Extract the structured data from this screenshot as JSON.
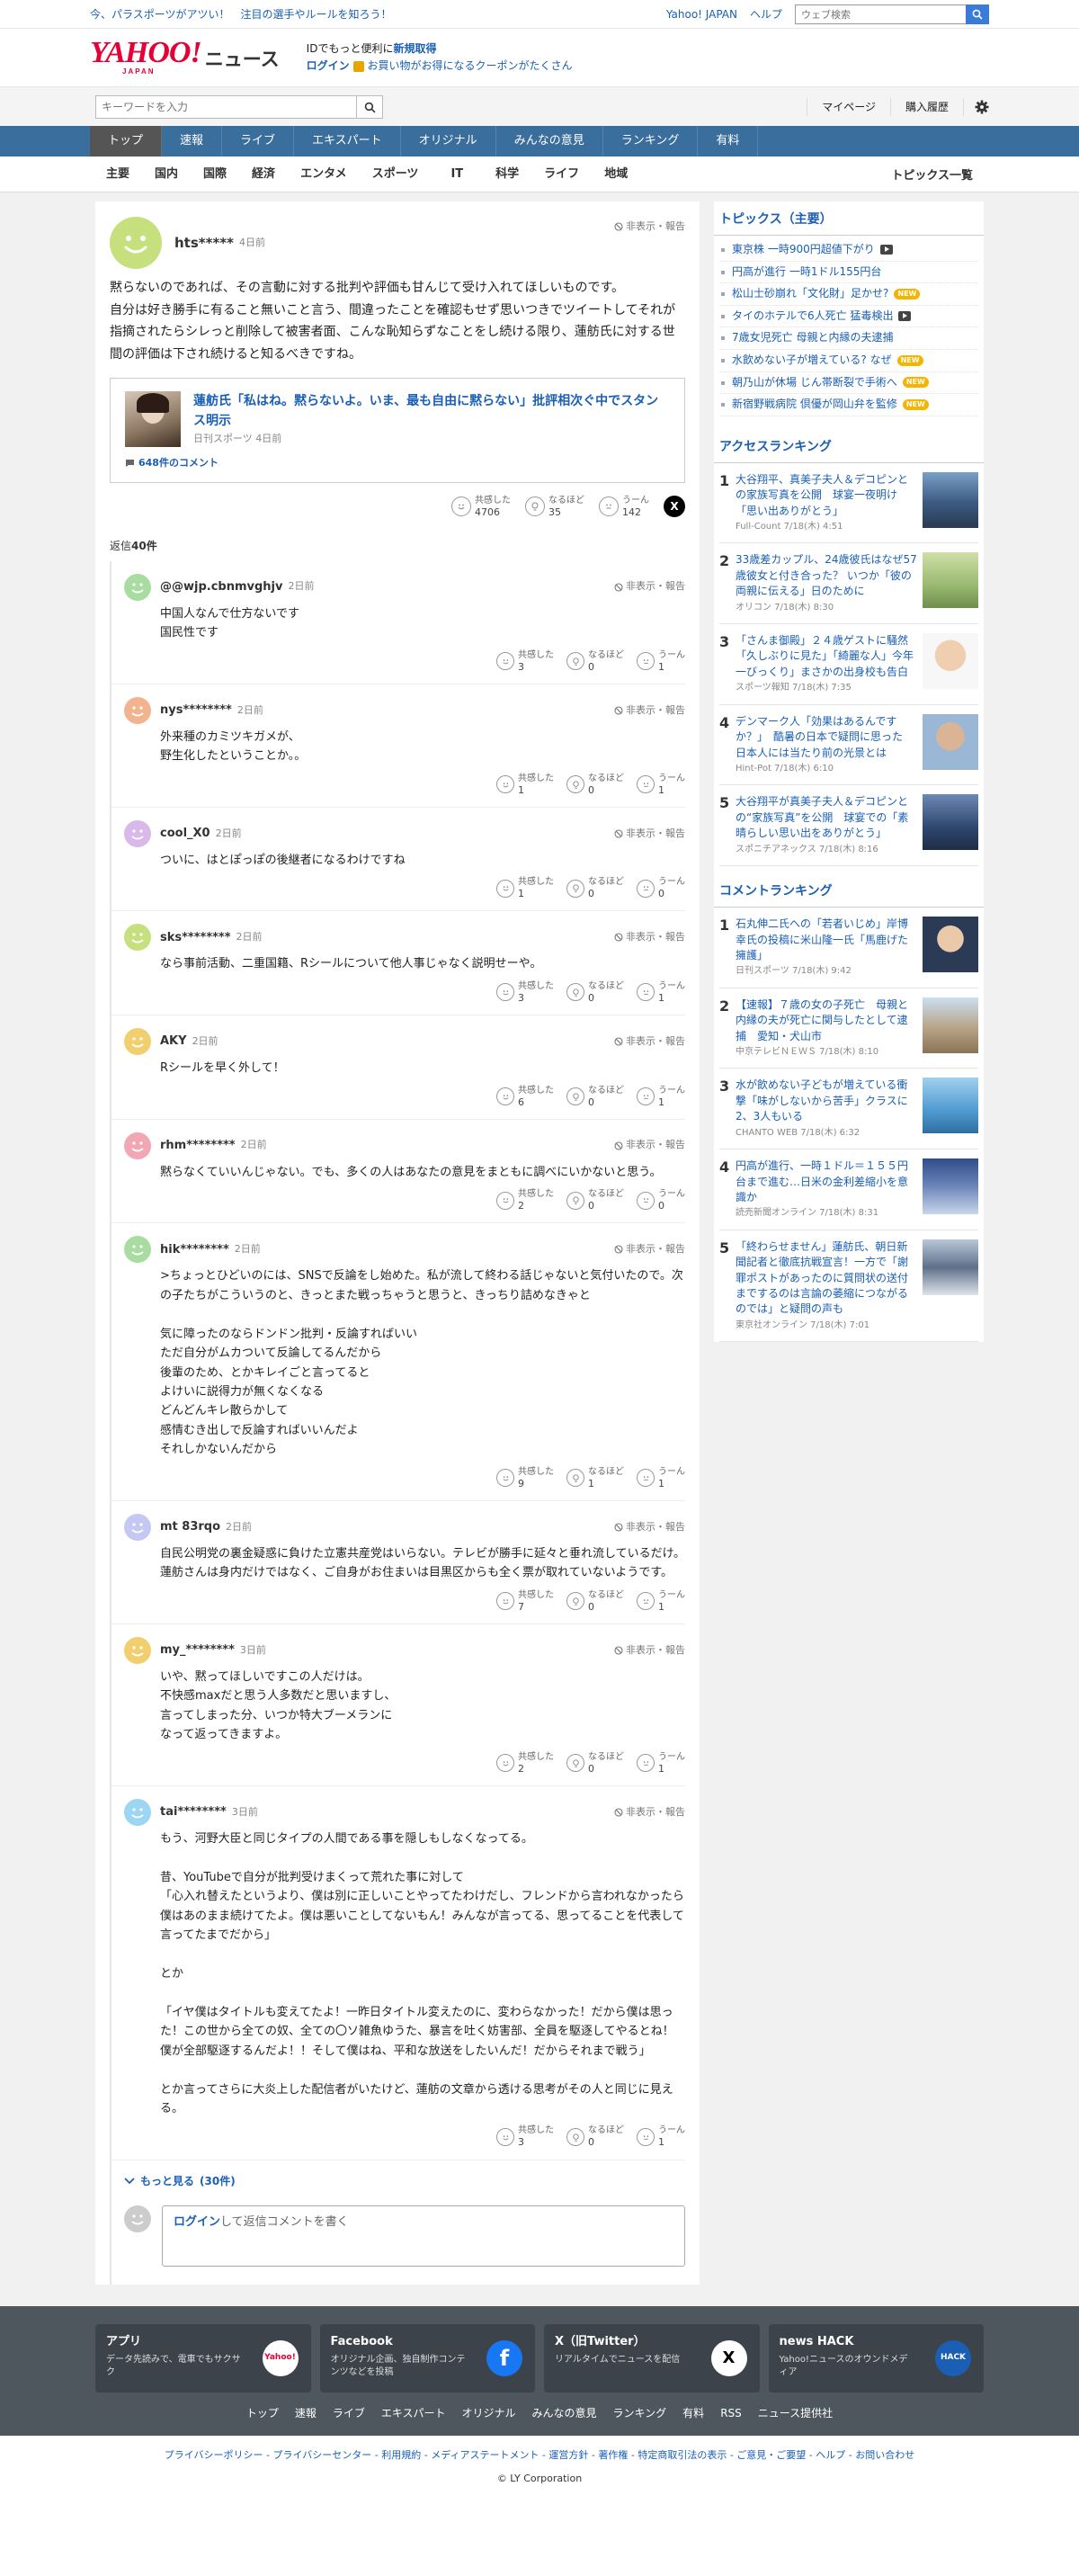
{
  "topbar": {
    "promo": "今、パラスポーツがアツい！　注目の選手やルールを知ろう！",
    "yahoo_link": "Yahoo! JAPAN",
    "help": "ヘルプ",
    "web_search_placeholder": "ウェブ検索"
  },
  "header": {
    "logo": "YAHOO!",
    "logo_sub": "JAPAN",
    "news": "ニュース",
    "id_text": "IDでもっと便利に",
    "signup": "新規取得",
    "login": "ログイン",
    "coupon_text": "お買い物がお得になるクーポンがたくさん"
  },
  "search": {
    "placeholder": "キーワードを入力",
    "mypage": "マイページ",
    "history": "購入履歴"
  },
  "nav": {
    "tabs": [
      "トップ",
      "速報",
      "ライブ",
      "エキスパート",
      "オリジナル",
      "みんなの意見",
      "ランキング",
      "有料"
    ]
  },
  "cats": {
    "items": [
      "主要",
      "国内",
      "国際",
      "経済",
      "エンタメ",
      "スポーツ",
      "IT",
      "科学",
      "ライフ",
      "地域"
    ],
    "more": "トピックス一覧"
  },
  "main_comment": {
    "user": "hts*****",
    "time": "4日前",
    "hide": "非表示・報告",
    "text": "黙らないのであれば、その言動に対する批判や評価も甘んじて受け入れてほしいものです。\n自分は好き勝手に有ること無いこと言う、間違ったことを確認もせず思いつきでツイートしてそれが指摘されたらシレっと削除して被害者面、こんな恥知らずなことをし続ける限り、蓮舫氏に対する世間の評価は下され続けると知るべきですね。",
    "card_title": "蓮舫氏「私はね。黙らないよ。いま、最も自由に黙らない」批評相次ぐ中でスタンス明示",
    "card_source": "日刊スポーツ 4日前",
    "card_comments": "648件のコメント",
    "r1": "共感した",
    "r1n": "4706",
    "r2": "なるほど",
    "r2n": "35",
    "r3": "うーん",
    "r3n": "142"
  },
  "reply_count_label": "返信",
  "reply_count": "40件",
  "replies": [
    {
      "user": "@@wjp.cbnmvghjv",
      "time": "2日前",
      "text": "中国人なんで仕方ないです\n国民性です",
      "a": "3",
      "b": "0",
      "c": "1"
    },
    {
      "user": "nys********",
      "time": "2日前",
      "text": "外来種のカミツキガメが、\n野生化したということか。。",
      "a": "1",
      "b": "0",
      "c": "1"
    },
    {
      "user": "cool_X0",
      "time": "2日前",
      "text": "ついに、はとぽっぽの後継者になるわけですね",
      "a": "1",
      "b": "0",
      "c": "0"
    },
    {
      "user": "sks********",
      "time": "2日前",
      "text": "なら事前活動、二重国籍、Rシールについて他人事じゃなく説明せーや。",
      "a": "3",
      "b": "0",
      "c": "1"
    },
    {
      "user": "AKY",
      "time": "2日前",
      "text": "Rシールを早く外して！",
      "a": "6",
      "b": "0",
      "c": "1"
    },
    {
      "user": "rhm********",
      "time": "2日前",
      "text": "黙らなくていいんじゃない。でも、多くの人はあなたの意見をまともに調べにいかないと思う。",
      "a": "2",
      "b": "0",
      "c": "0"
    },
    {
      "user": "hik********",
      "time": "2日前",
      "text": ">ちょっとひどいのには、SNSで反論をし始めた。私が流して終わる話じゃないと気付いたので。次の子たちがこういうのと、きっとまた戦っちゃうと思うと、きっちり詰めなきゃと\n\n気に障ったのならドンドン批判・反論すればいい\nただ自分がムカついて反論してるんだから\n後輩のため、とかキレイごと言ってると\nよけいに説得力が無くなくなる\nどんどんキレ散らかして\n感情むき出しで反論すればいいんだよ\nそれしかないんだから",
      "a": "9",
      "b": "1",
      "c": "1"
    },
    {
      "user": "mt 83rqo",
      "time": "2日前",
      "text": "自民公明党の裏金疑惑に負けた立憲共産党はいらない。テレビが勝手に延々と垂れ流しているだけ。　　蓮舫さんは身内だけではなく、ご自身がお住まいは目黒区からも全く票が取れていないようです。",
      "a": "7",
      "b": "0",
      "c": "1"
    },
    {
      "user": "my_********",
      "time": "3日前",
      "text": "いや、黙ってほしいですこの人だけは。\n不快感maxだと思う人多数だと思いますし、\n言ってしまった分、いつか特大ブーメランに\nなって返ってきますよ。",
      "a": "2",
      "b": "0",
      "c": "1"
    },
    {
      "user": "tai********",
      "time": "3日前",
      "text": "もう、河野大臣と同じタイプの人間である事を隠しもしなくなってる。\n\n昔、YouTubeで自分が批判受けまくって荒れた事に対して\n「心入れ替えたというより、僕は別に正しいことやってたわけだし、フレンドから言われなかったら僕はあのまま続けてたよ。僕は悪いことしてないもん！みんなが言ってる、思ってることを代表して言ってたまでだから」\n\nとか\n\n「イヤ僕はタイトルも変えてたよ！一昨日タイトル変えたのに、変わらなかった！だから僕は思った！この世から全ての奴、全ての〇ソ雑魚ゆうた、暴言を吐く妨害部、全員を駆逐してやるとね！僕が全部駆逐するんだよ！！そして僕はね、平和な放送をしたいんだ！だからそれまで戦う」\n\nとか言ってさらに大炎上した配信者がいたけど、蓮舫の文章から透ける思考がその人と同じに見える。",
      "a": "3",
      "b": "0",
      "c": "1"
    }
  ],
  "react_labels": {
    "a": "共感した",
    "b": "なるほど",
    "c": "うーん"
  },
  "more_replies": "もっと見る",
  "more_count": "(30件)",
  "reply_form": {
    "login": "ログイン",
    "text": "して返信コメントを書く"
  },
  "side": {
    "topics_title": "トピックス（主要）",
    "topics": [
      {
        "t": "東京株 一時900円超値下がり",
        "badge": "video"
      },
      {
        "t": "円高が進行 一時1ドル155円台",
        "badge": ""
      },
      {
        "t": "松山士砂崩れ「文化財」足かせ?",
        "badge": "NEW"
      },
      {
        "t": "タイのホテルで6人死亡 猛毒検出",
        "badge": "video"
      },
      {
        "t": "7歳女児死亡 母親と内縁の夫逮捕",
        "badge": ""
      },
      {
        "t": "水飲めない子が増えている? なぜ",
        "badge": "NEW"
      },
      {
        "t": "朝乃山が休場 じん帯断裂で手術へ",
        "badge": "NEW"
      },
      {
        "t": "新宿野戦病院 倶優が岡山弁を監修",
        "badge": "NEW"
      }
    ],
    "access_title": "アクセスランキング",
    "access": [
      {
        "n": "1",
        "t": "大谷翔平、真美子夫人＆デコピンとの家族写真を公開　球宴一夜明け「思い出ありがとう」",
        "s": "Full-Count 7/18(木) 4:51"
      },
      {
        "n": "2",
        "t": "33歳差カップル、24歳彼氏はなぜ57歳彼女と付き合った？ いつか「彼の両親に伝える」日のために",
        "s": "オリコン 7/18(木) 8:30"
      },
      {
        "n": "3",
        "t": "「さんま御殿」２４歳ゲストに騒然「久しぶりに見た」「綺麗な人」今年一びっくり」まさかの出身校も告白",
        "s": "スポーツ報知 7/18(木) 7:35"
      },
      {
        "n": "4",
        "t": "デンマーク人「効果はあるんですか？」　酷暑の日本で疑問に思った　日本人には当たり前の光景とは",
        "s": "Hint-Pot 7/18(木) 6:10"
      },
      {
        "n": "5",
        "t": "大谷翔平が真美子夫人＆デコピンとの“家族写真”を公開　球宴での「素晴らしい思い出をありがとう」",
        "s": "スポニチアネックス 7/18(木) 8:16"
      }
    ],
    "comment_title": "コメントランキング",
    "comments": [
      {
        "n": "1",
        "t": "石丸伸二氏への「若者いじめ」岸博幸氏の投稿に米山隆一氏「馬鹿げた擁護」",
        "s": "日刊スポーツ 7/18(木) 9:42"
      },
      {
        "n": "2",
        "t": "【速報】７歳の女の子死亡　母親と内縁の夫が死亡に関与したとして逮捕　愛知・犬山市",
        "s": "中京テレビＮＥＷＳ 7/18(木) 8:10"
      },
      {
        "n": "3",
        "t": "水が飲めない子どもが増えている衝撃「味がしないから苦手」クラスに2、3人もいる",
        "s": "CHANTO WEB 7/18(木) 6:32"
      },
      {
        "n": "4",
        "t": "円高が進行、一時１ドル＝１５５円台まで進む…日米の金利差縮小を意識か",
        "s": "読売新聞オンライン 7/18(木) 8:31"
      },
      {
        "n": "5",
        "t": "「終わらせません」蓮舫氏、朝日新聞記者と徹底抗戦宣言！一方で「謝罪ポストがあったのに質問状の送付までするのは言論の萎縮につながるのでは」と疑問の声も",
        "s": "東京社オンライン 7/18(木) 7:01"
      }
    ]
  },
  "footer": {
    "apps": [
      {
        "t": "アプリ",
        "d": "データ先読みで、電車でもサクサク",
        "i": "Yahoo!"
      },
      {
        "t": "Facebook",
        "d": "オリジナル企画、独自制作コンテンツなどを投稿",
        "i": "f"
      },
      {
        "t": "X（旧Twitter）",
        "d": "リアルタイムでニュースを配信",
        "i": "X"
      },
      {
        "t": "news HACK",
        "d": "Yahoo!ニュースのオウンドメディア",
        "i": "HACK"
      }
    ],
    "links": [
      "トップ",
      "速報",
      "ライブ",
      "エキスパート",
      "オリジナル",
      "みんなの意見",
      "ランキング",
      "有料",
      "RSS",
      "ニュース提供社"
    ],
    "legal": "プライバシーポリシー - プライバシーセンター - 利用規約 - メディアステートメント - 運営方針 - 著作権 - 特定商取引法の表示 - ご意見・ご要望 - ヘルプ - お問い合わせ",
    "copy": "© LY Corporation"
  },
  "colors": {
    "brand": "#e60033",
    "link": "#1a5fb4",
    "nav": "#3a6e9c"
  }
}
